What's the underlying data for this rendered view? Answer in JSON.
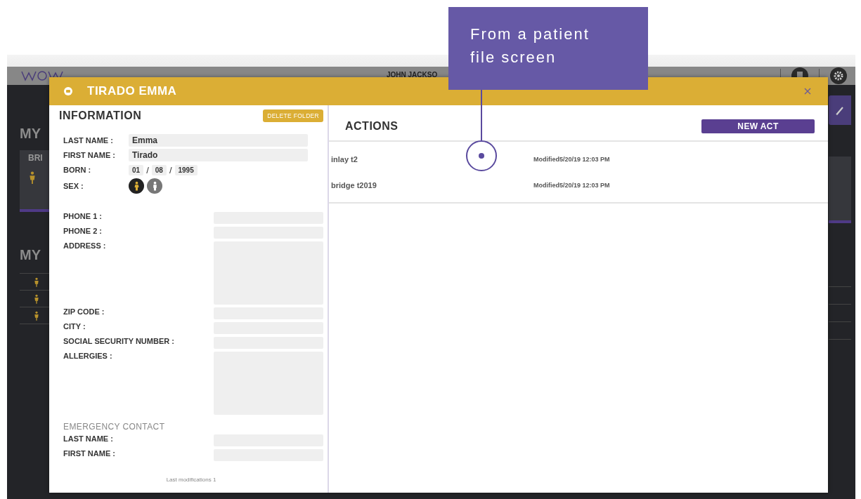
{
  "app_header": {
    "user_name": "JOHN JACKSO"
  },
  "background": {
    "section_titles": [
      "MY",
      "MY"
    ],
    "card_title": "BRI"
  },
  "modal": {
    "title": "TIRADO EMMA",
    "information": {
      "heading": "INFORMATION",
      "delete_button": "DELETE FOLDER",
      "identity": [
        {
          "label": "LAST NAME :",
          "value": "Emma"
        },
        {
          "label": "FIRST NAME :",
          "value": "Tirado"
        }
      ],
      "born": {
        "label": "BORN :",
        "day": "01",
        "month": "08",
        "year": "1995",
        "separator": "/"
      },
      "sex": {
        "label": "SEX :",
        "options": [
          {
            "kind": "female",
            "selected": true
          },
          {
            "kind": "male",
            "selected": false
          }
        ]
      },
      "contact_fields": [
        {
          "label": "PHONE 1 :",
          "kind": "line"
        },
        {
          "label": "PHONE 2 :",
          "kind": "line"
        },
        {
          "label": "ADDRESS :",
          "kind": "area"
        },
        {
          "label": "ZIP CODE :",
          "kind": "line"
        },
        {
          "label": "CITY :",
          "kind": "line"
        },
        {
          "label": "SOCIAL SECURITY NUMBER :",
          "kind": "line"
        },
        {
          "label": "ALLERGIES :",
          "kind": "area"
        }
      ],
      "emergency_heading": "EMERGENCY CONTACT",
      "emergency_fields": [
        {
          "label": "LAST NAME :",
          "kind": "line"
        },
        {
          "label": "FIRST NAME :",
          "kind": "line"
        }
      ],
      "footer": "Last modifications 1"
    },
    "actions": {
      "heading": "ACTIONS",
      "new_button": "NEW ACT",
      "rows": [
        {
          "name": "inlay t2",
          "modified": "Modified5/20/19 12:03 PM"
        },
        {
          "name": "bridge t2019",
          "modified": "Modified5/20/19 12:03 PM"
        }
      ]
    }
  },
  "callout": {
    "text": "From a patient file screen"
  }
}
